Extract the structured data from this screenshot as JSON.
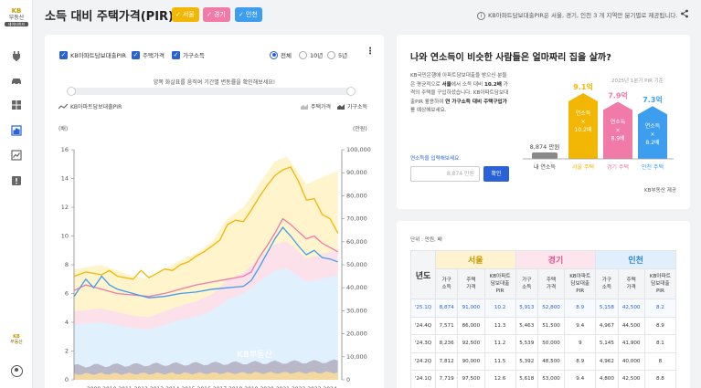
{
  "sidebar": {
    "logo_kb": "KB",
    "logo_name": "부동산",
    "logo_tag": "데이터허브",
    "bottom_label_1": "KB",
    "bottom_label_2": "부동산"
  },
  "header": {
    "title": "소득 대비 주택가격(PIR)",
    "chips": [
      "서울",
      "경기",
      "인천"
    ],
    "info_note": "KB아파트담보대출PIR은 서울, 경기, 인천 3 개 지역만 분기별로 제공됩니다."
  },
  "controls": {
    "checkboxes": [
      "KB아파트담보대출PIR",
      "주택가격",
      "가구소득"
    ],
    "period_options": [
      "전체",
      "10년",
      "5년"
    ],
    "selected_period": "전체",
    "range_hint": "양쪽 화살표를 움직여 기간별 변동률을 확인해보세요!",
    "legend_left": "KB아파트담보대출PIR",
    "legend_house": "주택가격",
    "legend_income": "가구소득"
  },
  "chart_data": {
    "type": "line",
    "left_axis_unit": "(배)",
    "right_axis_unit": "(만원)",
    "left_ticks": [
      "16",
      "14",
      "12",
      "10",
      "8",
      "6",
      "4",
      "2",
      "0"
    ],
    "right_ticks": [
      "100,000",
      "90,000",
      "80,000",
      "70,000",
      "60,000",
      "50,000",
      "40,000",
      "30,000",
      "20,000",
      "10,000",
      "0"
    ],
    "x_ticks": [
      "2009",
      "2010",
      "2011",
      "2012",
      "2013",
      "2014",
      "2015",
      "2016",
      "2017",
      "2018",
      "2019",
      "2020",
      "2021",
      "2022",
      "2023",
      "2024"
    ],
    "ylim_left": [
      0,
      16
    ],
    "ylim_right": [
      0,
      100000
    ],
    "x_range": [
      2008.25,
      2025.25
    ],
    "watermark": "KB부동산",
    "series": [
      {
        "name": "서울",
        "color": "#f2b705",
        "pir": [
          [
            2008.25,
            7.2
          ],
          [
            2009,
            7.5
          ],
          [
            2010,
            7.3
          ],
          [
            2010.5,
            7.6
          ],
          [
            2011,
            7.2
          ],
          [
            2012,
            7.0
          ],
          [
            2012.5,
            7.6
          ],
          [
            2013,
            7.1
          ],
          [
            2013.5,
            7.4
          ],
          [
            2014,
            7.7
          ],
          [
            2014.5,
            7.6
          ],
          [
            2015,
            8.0
          ],
          [
            2015.5,
            8.2
          ],
          [
            2016,
            8.6
          ],
          [
            2016.5,
            8.9
          ],
          [
            2017,
            9.3
          ],
          [
            2017.5,
            9.7
          ],
          [
            2018,
            10.8
          ],
          [
            2018.5,
            11.1
          ],
          [
            2019,
            11.0
          ],
          [
            2019.5,
            11.8
          ],
          [
            2020,
            12.7
          ],
          [
            2020.5,
            13.5
          ],
          [
            2021,
            14.2
          ],
          [
            2021.5,
            14.6
          ],
          [
            2022,
            14.8
          ],
          [
            2022.5,
            13.8
          ],
          [
            2023,
            12.5
          ],
          [
            2023.5,
            12.6
          ],
          [
            2024,
            11.5
          ],
          [
            2024.5,
            11.2
          ],
          [
            2025,
            10.2
          ]
        ],
        "price_band": [
          [
            2008.25,
            48000
          ],
          [
            2010,
            50000
          ],
          [
            2012,
            45000
          ],
          [
            2013,
            44000
          ],
          [
            2014,
            48000
          ],
          [
            2015,
            52000
          ],
          [
            2016,
            55000
          ],
          [
            2017,
            60000
          ],
          [
            2018,
            70000
          ],
          [
            2019,
            75000
          ],
          [
            2020,
            85000
          ],
          [
            2021,
            95000
          ],
          [
            2021.75,
            97000
          ],
          [
            2022.5,
            90000
          ],
          [
            2023,
            85000
          ],
          [
            2024,
            88000
          ],
          [
            2025,
            91000
          ]
        ]
      },
      {
        "name": "경기",
        "color": "#f07aa8",
        "pir": [
          [
            2008.25,
            6.2
          ],
          [
            2009,
            6.6
          ],
          [
            2010,
            6.3
          ],
          [
            2011,
            6.0
          ],
          [
            2012,
            5.9
          ],
          [
            2013,
            5.8
          ],
          [
            2014,
            6.0
          ],
          [
            2015,
            6.3
          ],
          [
            2016,
            6.6
          ],
          [
            2017,
            6.8
          ],
          [
            2018,
            7.0
          ],
          [
            2019,
            7.2
          ],
          [
            2019.5,
            7.5
          ],
          [
            2020,
            8.5
          ],
          [
            2020.5,
            9.3
          ],
          [
            2021,
            10.2
          ],
          [
            2021.5,
            11.2
          ],
          [
            2022,
            10.8
          ],
          [
            2022.5,
            10.3
          ],
          [
            2023,
            9.8
          ],
          [
            2023.5,
            10.0
          ],
          [
            2024,
            9.5
          ],
          [
            2024.5,
            9.2
          ],
          [
            2025,
            8.9
          ]
        ]
      },
      {
        "name": "인천",
        "color": "#3d9ef0",
        "pir": [
          [
            2008.25,
            5.8
          ],
          [
            2009,
            7.0
          ],
          [
            2009.5,
            6.4
          ],
          [
            2010,
            7.2
          ],
          [
            2010.5,
            6.6
          ],
          [
            2011,
            6.3
          ],
          [
            2012,
            6.0
          ],
          [
            2013,
            5.7
          ],
          [
            2014,
            5.8
          ],
          [
            2015,
            6.0
          ],
          [
            2016,
            6.1
          ],
          [
            2017,
            6.3
          ],
          [
            2018,
            6.4
          ],
          [
            2019,
            6.5
          ],
          [
            2019.5,
            6.9
          ],
          [
            2020,
            7.8
          ],
          [
            2020.5,
            8.8
          ],
          [
            2021,
            9.8
          ],
          [
            2021.5,
            10.6
          ],
          [
            2022,
            10.0
          ],
          [
            2022.5,
            9.3
          ],
          [
            2023,
            8.7
          ],
          [
            2023.5,
            9.0
          ],
          [
            2024,
            8.5
          ],
          [
            2024.5,
            8.4
          ],
          [
            2025,
            8.2
          ]
        ]
      }
    ]
  },
  "pir_card": {
    "title": "나와 연소득이 비슷한 사람들은 얼마짜리 집을 살까?",
    "desc_1": "KB국민은행에 아파트담보대출을 받으신 분들은 평균적으로",
    "desc_seoul": "서울",
    "desc_2": "에서 소득 대비",
    "desc_ratio": "10.2배",
    "desc_3": "가격의 주택을 구입하셨습니다. KB아파트담보대출PIR 활용하여",
    "desc_bold": "연 가구소득 대비 주택구입가",
    "desc_4": "를 예상해보세요.",
    "income_label": "연소득을 입력해보세요.",
    "income_placeholder": "8,874 만원",
    "confirm_label": "확인",
    "ref_note": "2025년 1분기 PIR 기준",
    "source": "KB부동산 제공",
    "bars": [
      {
        "label": "내 연소득",
        "value_label": "8,874 만원",
        "color": "#888888",
        "amount": 0.8874,
        "inside": []
      },
      {
        "label": "서울 주택",
        "value_label": "9.1억",
        "color": "#f2b705",
        "amount": 9.1,
        "inside": [
          "연소득",
          "×",
          "10.2배"
        ]
      },
      {
        "label": "경기 주택",
        "value_label": "7.9억",
        "color": "#f07aa8",
        "amount": 7.9,
        "inside": [
          "연소득",
          "×",
          "8.9배"
        ]
      },
      {
        "label": "인천 주택",
        "value_label": "7.3억",
        "color": "#3d9ef0",
        "amount": 7.3,
        "inside": [
          "연소득",
          "×",
          "8.2배"
        ]
      }
    ]
  },
  "table": {
    "unit_note": "단위 : 만원, 배",
    "year_header": "년도",
    "regions": [
      "서울",
      "경기",
      "인천"
    ],
    "sub_headers": [
      "가구\n소득",
      "주택\n가격",
      "KB아파트\n담보대출\nPIR"
    ],
    "rows": [
      [
        "'25.1Q",
        "8,874",
        "91,000",
        "10.2",
        "5,913",
        "52,800",
        "8.9",
        "5,158",
        "42,500",
        "8.2"
      ],
      [
        "'24.4Q",
        "7,571",
        "86,000",
        "11.3",
        "5,463",
        "51,500",
        "9.4",
        "4,967",
        "44,500",
        "8.9"
      ],
      [
        "'24.3Q",
        "8,236",
        "92,500",
        "11.2",
        "5,539",
        "50,000",
        "9",
        "5,145",
        "41,900",
        "8.1"
      ],
      [
        "'24.2Q",
        "7,812",
        "90,000",
        "11.5",
        "5,392",
        "48,500",
        "8.9",
        "4,962",
        "40,000",
        "8"
      ],
      [
        "'24.1Q",
        "7,719",
        "97,500",
        "12.6",
        "5,618",
        "53,000",
        "9.4",
        "4,800",
        "42,500",
        "8.8"
      ]
    ]
  },
  "colors": {
    "accent": "#2a62d6",
    "seoul": "#f2b705",
    "gyeonggi": "#f07aa8",
    "incheon": "#3d9ef0"
  }
}
